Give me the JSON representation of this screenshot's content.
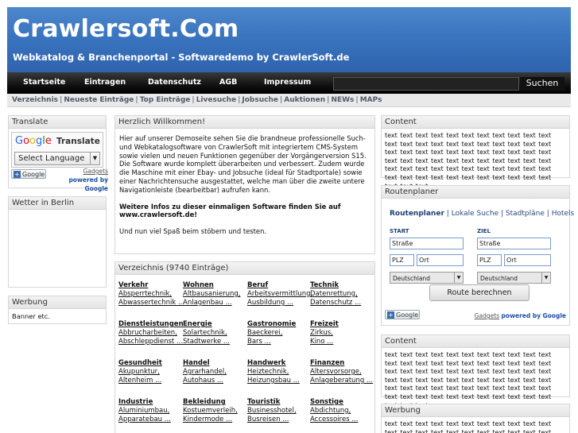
{
  "header": {
    "title": "Crawlersoft.Com",
    "subtitle": "Webkatalog & Branchenportal - Softwaredemo by CrawlerSoft.de"
  },
  "nav": {
    "items": [
      "Startseite",
      "Eintragen",
      "Datenschutz",
      "AGB",
      "Impressum"
    ],
    "search_button": "Suchen",
    "search_value": ""
  },
  "subnav": {
    "links": [
      "Verzeichnis",
      "Neueste Einträge",
      "Top Einträge",
      "Livesuche",
      "Jobsuche",
      "Auktionen",
      "NEWs",
      "MAPs"
    ]
  },
  "left": {
    "translate": {
      "title": "Translate",
      "google_word": "Google",
      "translate_word": "Translate",
      "select_label": "Select Language",
      "badge": "Google",
      "gadgets": "Gadgets",
      "powered": "powered by",
      "google": "Google"
    },
    "weather": {
      "title": "Wetter in Berlin"
    },
    "ads": {
      "title": "Werbung",
      "text": "Banner etc."
    }
  },
  "center": {
    "welcome": {
      "title": "Herzlich Willkommen!",
      "p1": "Hier auf unserer Demoseite sehen Sie die brandneue professionelle Such- und Webkatalogsoftware von CrawlerSoft mit integriertem CMS-System sowie vielen und neuen Funktionen gegenüber der Vorgängerversion S15. Die Software wurde komplett überarbeiten und verbessert. Zudem wurde die Maschine mit einer Ebay- und Jobsuche (ideal für Stadtportale) sowie einer Nachrichtensuche ausgestattet, welche man über die zweite untere Navigationleiste (bearbeitbar) aufrufen kann.",
      "p2": "Weitere Infos zu dieser einmaligen Software finden Sie auf www.crawlersoft.de!",
      "p3": "Und nun viel Spaß beim stöbern und testen."
    },
    "directory": {
      "title": "Verzeichnis (9740 Einträge)",
      "categories": [
        {
          "name": "Verkehr",
          "subs": [
            "Absperrtechnik,",
            "Abwassertechnik ..."
          ]
        },
        {
          "name": "Wohnen",
          "subs": [
            "Altbausanierung,",
            "Anlagenbau ..."
          ]
        },
        {
          "name": "Beruf",
          "subs": [
            "Arbeitsvermittlung,",
            "Ausbildung ..."
          ]
        },
        {
          "name": "Technik",
          "subs": [
            "Datenrettung,",
            "Datenschutz ..."
          ]
        },
        {
          "name": "Dienstleistungen",
          "subs": [
            "Abbrucharbeiten,",
            "Abschleppdienst ..."
          ]
        },
        {
          "name": "Energie",
          "subs": [
            "Solartechnik,",
            "Stadtwerke ..."
          ]
        },
        {
          "name": "Gastronomie",
          "subs": [
            "Baeckerei,",
            "Bars ..."
          ]
        },
        {
          "name": "Freizeit",
          "subs": [
            "Zirkus,",
            "Kino ..."
          ]
        },
        {
          "name": "Gesundheit",
          "subs": [
            "Akupunktur,",
            "Altenheim ..."
          ]
        },
        {
          "name": "Handel",
          "subs": [
            "Agrarhandel,",
            "Autohaus ..."
          ]
        },
        {
          "name": "Handwerk",
          "subs": [
            "Heiztechnik,",
            "Heizungsbau ..."
          ]
        },
        {
          "name": "Finanzen",
          "subs": [
            "Altersvorsorge,",
            "Anlageberatung ..."
          ]
        },
        {
          "name": "Industrie",
          "subs": [
            "Aluminiumbau,",
            "Apparatebau ..."
          ]
        },
        {
          "name": "Bekleidung",
          "subs": [
            "Kostuemverleih,",
            "Kindermode ..."
          ]
        },
        {
          "name": "Touristik",
          "subs": [
            "Businesshotel,",
            "Busreisen ..."
          ]
        },
        {
          "name": "Sonstige",
          "subs": [
            "Abdichtung,",
            "Accessoires ..."
          ]
        }
      ]
    }
  },
  "right": {
    "content1": {
      "title": "Content",
      "text": "text text text text text text text text text text text text text text text text text text text text text text text text text text text text text text text text text text text text text text text text text text text text text text text text text text text text text text text text text text text text text text text text text text text text text"
    },
    "route": {
      "title": "Routenplaner",
      "tab_active": "Routenplaner",
      "tabs": [
        "Lokale Suche",
        "Stadtpläne",
        "Hotels"
      ],
      "start_label": "START",
      "ziel_label": "ZIEL",
      "street_placeholder": "Straße",
      "plz_placeholder": "PLZ",
      "ort_placeholder": "Ort",
      "country": "Deutschland",
      "button": "Route berechnen",
      "badge": "Google",
      "gadgets": "Gadgets",
      "powered": "powered by",
      "google": "Google"
    },
    "content2": {
      "title": "Content",
      "text": "text text text text text text text text text text text text text text text text text text text text text text text text text text text text text text text text text text text text text text text text text text text text text text text text text text text text text text text text text text text text text text text text text text text text text"
    },
    "ads": {
      "title": "Werbung",
      "text": "text text text text text text text text text text text text text text text text text text text text text text"
    }
  }
}
